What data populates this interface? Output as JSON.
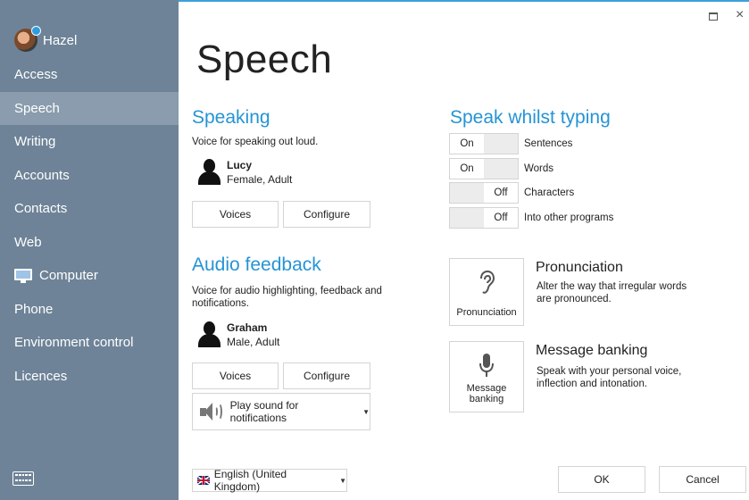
{
  "sidebar": {
    "user": "Hazel",
    "items": [
      {
        "label": "Access"
      },
      {
        "label": "Speech"
      },
      {
        "label": "Writing"
      },
      {
        "label": "Accounts"
      },
      {
        "label": "Contacts"
      },
      {
        "label": "Web"
      },
      {
        "label": "Computer"
      },
      {
        "label": "Phone"
      },
      {
        "label": "Environment control"
      },
      {
        "label": "Licences"
      }
    ],
    "active": "Speech"
  },
  "window": {
    "maximize": "□",
    "close": "×"
  },
  "page": {
    "title": "Speech"
  },
  "speaking": {
    "title": "Speaking",
    "description": "Voice for speaking out loud.",
    "voice_name": "Lucy",
    "voice_desc": "Female, Adult",
    "voices_button": "Voices",
    "configure_button": "Configure"
  },
  "audio_feedback": {
    "title": "Audio feedback",
    "description": "Voice for audio highlighting, feedback and notifications.",
    "voice_name": "Graham",
    "voice_desc": "Male, Adult",
    "voices_button": "Voices",
    "configure_button": "Configure",
    "sound_dropdown": "Play sound for notifications"
  },
  "speak_whilst_typing": {
    "title": "Speak whilst typing",
    "toggles": [
      {
        "label": "Sentences",
        "state": "On"
      },
      {
        "label": "Words",
        "state": "On"
      },
      {
        "label": "Characters",
        "state": "Off"
      },
      {
        "label": "Into other programs",
        "state": "Off"
      }
    ]
  },
  "pronunciation": {
    "button_label": "Pronunciation",
    "title": "Pronunciation",
    "description": "Alter the way that irregular words are pronounced."
  },
  "message_banking": {
    "button_label": "Message banking",
    "title": "Message banking",
    "description": "Speak with your personal voice, inflection and intonation."
  },
  "footer": {
    "language": "English (United Kingdom)",
    "ok": "OK",
    "cancel": "Cancel"
  },
  "colors": {
    "sidebar": "#6e8397",
    "sidebar_active": "#8a9cad",
    "accent": "#2594d4"
  }
}
